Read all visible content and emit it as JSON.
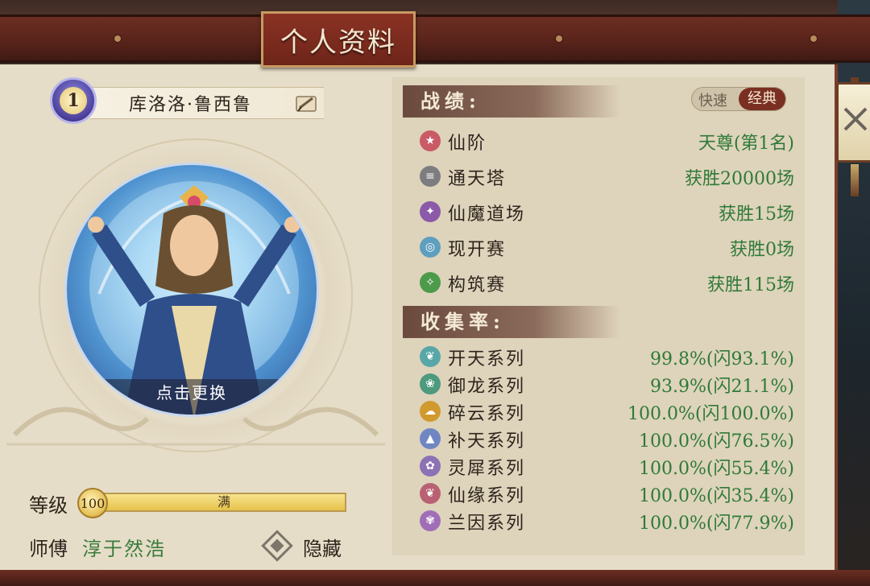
{
  "title": "个人资料",
  "profile": {
    "rank_badge": "1",
    "name": "库洛洛·鲁西鲁",
    "change_portrait_label": "点击更换",
    "level_label": "等级",
    "level_value": "100",
    "level_bar_text": "满",
    "level_progress": 1.0,
    "master_label": "师傅",
    "master_name": "淳于然浩",
    "hide_label": "隐藏"
  },
  "stats": {
    "section_title": "战绩:",
    "mode_toggle": {
      "quick": "快速",
      "classic": "经典",
      "selected": "classic"
    },
    "rows": [
      {
        "icon": "star-icon",
        "color": "#c95b67",
        "label": "仙阶",
        "value": "天尊(第1名)"
      },
      {
        "icon": "tower-icon",
        "color": "#7d7d80",
        "label": "通天塔",
        "value": "获胜20000场"
      },
      {
        "icon": "bird-icon",
        "color": "#8b5aa8",
        "label": "仙魔道场",
        "value": "获胜15场"
      },
      {
        "icon": "search-icon",
        "color": "#5e9fbf",
        "label": "现开赛",
        "value": "获胜0场"
      },
      {
        "icon": "feather-icon",
        "color": "#4d9a4a",
        "label": "构筑赛",
        "value": "获胜115场"
      }
    ]
  },
  "collection": {
    "section_title": "收集率:",
    "rows": [
      {
        "icon": "leaf-icon",
        "color": "#58a7a8",
        "label": "开天系列",
        "value": "99.8%(闪93.1%)"
      },
      {
        "icon": "dragon-icon",
        "color": "#4d9a7e",
        "label": "御龙系列",
        "value": "93.9%(闪21.1%)"
      },
      {
        "icon": "cloud-icon",
        "color": "#d19a2e",
        "label": "碎云系列",
        "value": "100.0%(闪100.0%)"
      },
      {
        "icon": "mountain-icon",
        "color": "#6f86c3",
        "label": "补天系列",
        "value": "100.0%(闪76.5%)"
      },
      {
        "icon": "flame-icon",
        "color": "#8c72b5",
        "label": "灵犀系列",
        "value": "100.0%(闪55.4%)"
      },
      {
        "icon": "leaf-icon",
        "color": "#b96172",
        "label": "仙缘系列",
        "value": "100.0%(闪35.4%)"
      },
      {
        "icon": "flower-icon",
        "color": "#a06eb7",
        "label": "兰因系列",
        "value": "100.0%(闪77.9%)"
      }
    ]
  }
}
